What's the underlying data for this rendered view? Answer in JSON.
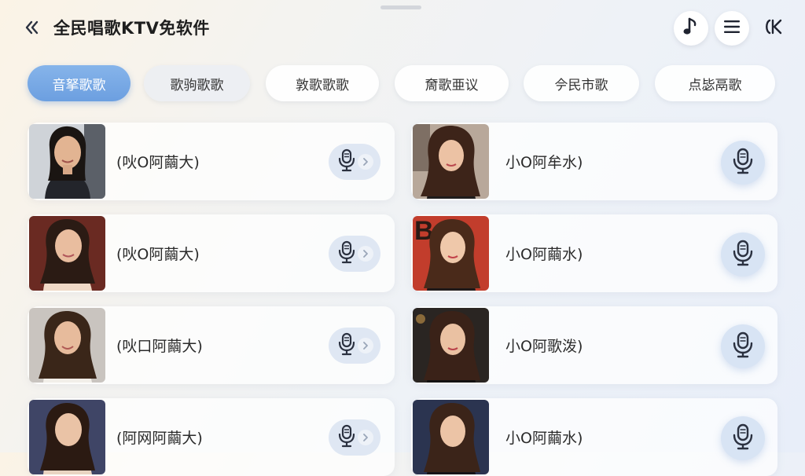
{
  "header": {
    "title": "全民唱歌KTV免软件",
    "back_icon": "double-chevron-left-icon",
    "music_icon": "music-note-icon",
    "menu_icon": "hamburger-menu-icon",
    "exit_icon": "exit-icon"
  },
  "tabs": [
    {
      "label": "音拏歌歌",
      "active": true
    },
    {
      "label": "歌驹歌歌",
      "active": false
    },
    {
      "label": "敦歌歌歌",
      "active": false
    },
    {
      "label": "奝歌亜议",
      "active": false
    },
    {
      "label": "𫝆民市歌",
      "active": false
    },
    {
      "label": "点毖鬲歌",
      "active": false
    }
  ],
  "singers_left": [
    {
      "name": "(吙O阿繭大)"
    },
    {
      "name": "(吙O阿繭大)"
    },
    {
      "name": "(吙口阿繭大)"
    },
    {
      "name": "(阿网阿繭大)"
    }
  ],
  "singers_right": [
    {
      "name": "小O阿牟水)"
    },
    {
      "name": "小O阿繭水)"
    },
    {
      "name": "小O阿歌泼)"
    },
    {
      "name": "小O阿繭水)"
    }
  ],
  "colors": {
    "accent": "#6c9fe0",
    "mic_bg": "#dfe7f3",
    "icon_dark": "#2b3140"
  }
}
